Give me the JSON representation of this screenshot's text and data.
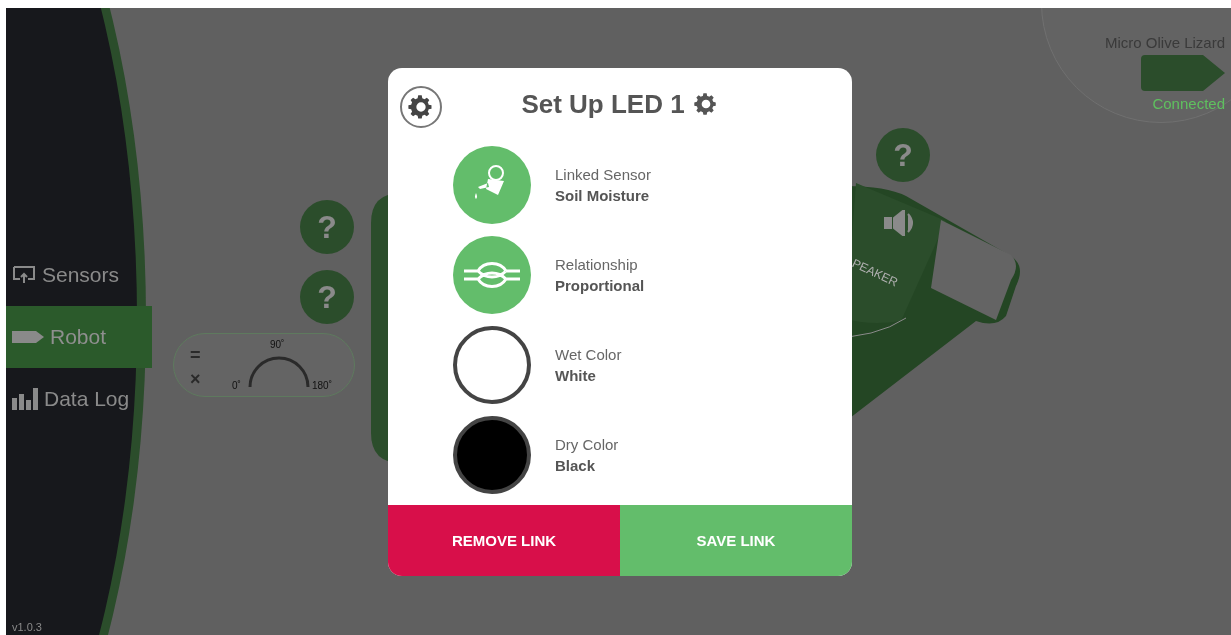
{
  "sidebar": {
    "items": [
      {
        "label": "Sensors",
        "kind": "sensors",
        "selected": false
      },
      {
        "label": "Robot",
        "kind": "robot",
        "selected": true
      },
      {
        "label": "Data Log",
        "kind": "datalog",
        "selected": false
      }
    ],
    "version": "v1.0.3"
  },
  "robot_status": {
    "name": "Micro Olive Lizard",
    "status": "Connected"
  },
  "canvas": {
    "help_buttons": [
      "?",
      "?",
      "?"
    ],
    "servo": {
      "equals": "=",
      "times": "×",
      "tick_top": "90˚",
      "tick_left": "0˚",
      "tick_right": "180˚"
    },
    "speaker_label": "PEAKER"
  },
  "dialog": {
    "title": "Set Up LED 1",
    "rows": [
      {
        "kind": "sensor",
        "label": "Linked Sensor",
        "value": "Soil Moisture"
      },
      {
        "kind": "relationship",
        "label": "Relationship",
        "value": "Proportional"
      },
      {
        "kind": "color",
        "label": "Wet Color",
        "value": "White",
        "color": "#ffffff"
      },
      {
        "kind": "color",
        "label": "Dry Color",
        "value": "Black",
        "color": "#000000"
      }
    ],
    "buttons": [
      {
        "label": "REMOVE LINK",
        "kind": "remove"
      },
      {
        "label": "SAVE LINK",
        "kind": "save"
      }
    ]
  }
}
